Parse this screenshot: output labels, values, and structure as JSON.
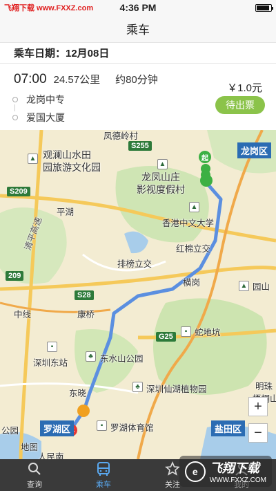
{
  "status_bar": {
    "carrier_watermark": "飞翔下载 www.FXXZ.com",
    "time": "4:36 PM"
  },
  "nav": {
    "title": "乘车"
  },
  "date_bar": {
    "label": "乘车日期：12月08日"
  },
  "trip": {
    "departure_time": "07:00",
    "distance": "24.57公里",
    "duration": "约80分钟",
    "stops": [
      "龙岗中专",
      "爱国大厦"
    ],
    "price": "￥1.0元",
    "ticket_button": "待出票"
  },
  "map": {
    "labels": [
      "凤德岭村",
      "观澜山水田",
      "园旅游文化园",
      "龙凤山庄",
      "影视度假村",
      "平湖",
      "香港中文大学",
      "清平高速",
      "红棉立交",
      "排榜立交",
      "横岗",
      "康桥",
      "园山",
      "蛇地坑",
      "中线",
      "深圳东站",
      "东水山公园",
      "深圳仙湖植物园",
      "东晓",
      "罗湖体育馆",
      "明珠",
      "梧桐山",
      "公园",
      "人民南",
      "地图"
    ],
    "road_badges": [
      "S255",
      "S209",
      "S28",
      "G25",
      "209"
    ],
    "districts": [
      "龙岗区",
      "罗湖区",
      "盐田区"
    ],
    "start_marker": "起",
    "end_marker": "终",
    "route_color": "#5b8fe0",
    "zoom_in": "+",
    "zoom_out": "−"
  },
  "tabs": [
    {
      "label": "查询",
      "icon": "search-icon"
    },
    {
      "label": "乘车",
      "icon": "bus-icon",
      "active": true
    },
    {
      "label": "关注",
      "icon": "star-icon"
    },
    {
      "label": "我的",
      "icon": "user-icon"
    }
  ],
  "overlay_watermark": {
    "brand": "飞翔下载",
    "url": "WWW.FXXZ.COM"
  }
}
